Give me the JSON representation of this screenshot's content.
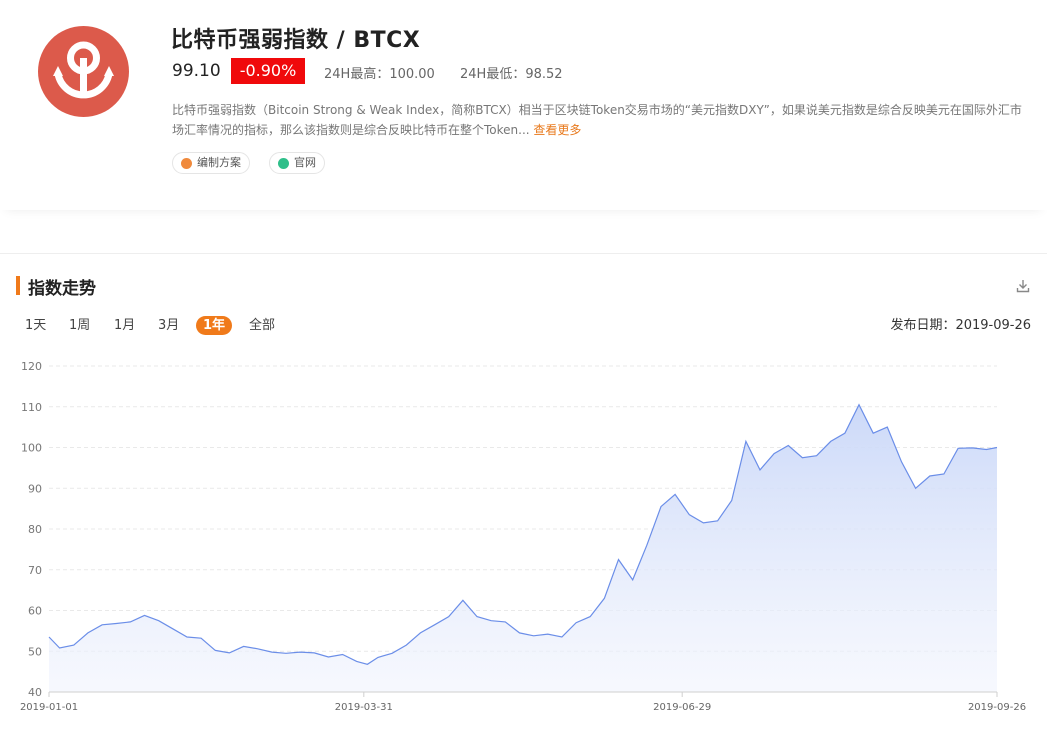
{
  "header": {
    "title": "比特币强弱指数 / BTCX",
    "price": "99.10",
    "change": "-0.90%",
    "high_label": "24H最高：100.00",
    "low_label": "24H最低：98.52",
    "description": "比特币强弱指数（Bitcoin Strong & Weak Index，简称BTCX）相当于区块链Token交易市场的“美元指数DXY”，如果说美元指数是综合反映美元在国际外汇市场汇率情况的指标，那么该指数则是综合反映比特币在整个Token...",
    "more_label": "查看更多",
    "tags": [
      "编制方案",
      "官网"
    ],
    "colors": {
      "logo": "#dc5a4b",
      "change_bg": "#f0090b",
      "accent": "#f07a1a"
    }
  },
  "section": {
    "title": "指数走势",
    "download_icon": "download-icon",
    "tabs": [
      "1天",
      "1周",
      "1月",
      "3月",
      "1年",
      "全部"
    ],
    "active_tab": "1年",
    "publish_date": "发布日期：2019-09-26"
  },
  "chart_data": {
    "type": "area",
    "title": "",
    "xlabel": "",
    "ylabel": "",
    "ylim": [
      40,
      120
    ],
    "yticks": [
      "40",
      "50",
      "60",
      "70",
      "80",
      "90",
      "100",
      "110",
      "120"
    ],
    "xticks": [
      "2019-01-01",
      "2019-03-31",
      "2019-06-29",
      "2019-09-26"
    ],
    "grid": true,
    "line_color": "#6b8ee8",
    "series": [
      {
        "x": [
          "2019-01-01",
          "2019-01-04",
          "2019-01-08",
          "2019-01-12",
          "2019-01-16",
          "2019-01-20",
          "2019-01-24",
          "2019-01-28",
          "2019-02-01",
          "2019-02-05",
          "2019-02-09",
          "2019-02-13",
          "2019-02-17",
          "2019-02-21",
          "2019-02-25",
          "2019-03-01",
          "2019-03-05",
          "2019-03-09",
          "2019-03-13",
          "2019-03-17",
          "2019-03-21",
          "2019-03-25",
          "2019-03-29",
          "2019-04-01",
          "2019-04-04",
          "2019-04-08",
          "2019-04-12",
          "2019-04-16",
          "2019-04-20",
          "2019-04-24",
          "2019-04-28",
          "2019-05-02",
          "2019-05-06",
          "2019-05-10",
          "2019-05-14",
          "2019-05-18",
          "2019-05-22",
          "2019-05-26",
          "2019-05-30",
          "2019-06-03",
          "2019-06-07",
          "2019-06-11",
          "2019-06-15",
          "2019-06-19",
          "2019-06-23",
          "2019-06-27",
          "2019-07-01",
          "2019-07-05",
          "2019-07-09",
          "2019-07-13",
          "2019-07-17",
          "2019-07-21",
          "2019-07-25",
          "2019-07-29",
          "2019-08-02",
          "2019-08-06",
          "2019-08-10",
          "2019-08-14",
          "2019-08-18",
          "2019-08-22",
          "2019-08-26",
          "2019-08-30",
          "2019-09-03",
          "2019-09-07",
          "2019-09-11",
          "2019-09-15",
          "2019-09-19",
          "2019-09-23",
          "2019-09-26"
        ],
        "values": [
          53.5,
          50.8,
          51.5,
          54.5,
          56.5,
          56.8,
          57.2,
          58.8,
          57.5,
          55.5,
          53.5,
          53.2,
          50.2,
          49.6,
          51.2,
          50.6,
          49.8,
          49.5,
          49.8,
          49.6,
          48.6,
          49.2,
          47.5,
          46.8,
          48.5,
          49.5,
          51.5,
          54.5,
          56.5,
          58.5,
          62.5,
          58.5,
          57.5,
          57.2,
          54.5,
          53.8,
          54.2,
          53.5,
          57.0,
          58.5,
          63.0,
          72.5,
          67.5,
          76.0,
          85.5,
          88.5,
          83.5,
          81.5,
          82.0,
          87.0,
          101.5,
          94.5,
          98.5,
          100.5,
          97.5,
          98.0,
          101.5,
          103.5,
          110.5,
          103.5,
          105.0,
          96.5,
          90.0,
          93.0,
          93.5,
          99.8,
          99.9,
          99.5,
          100.0
        ]
      }
    ]
  }
}
